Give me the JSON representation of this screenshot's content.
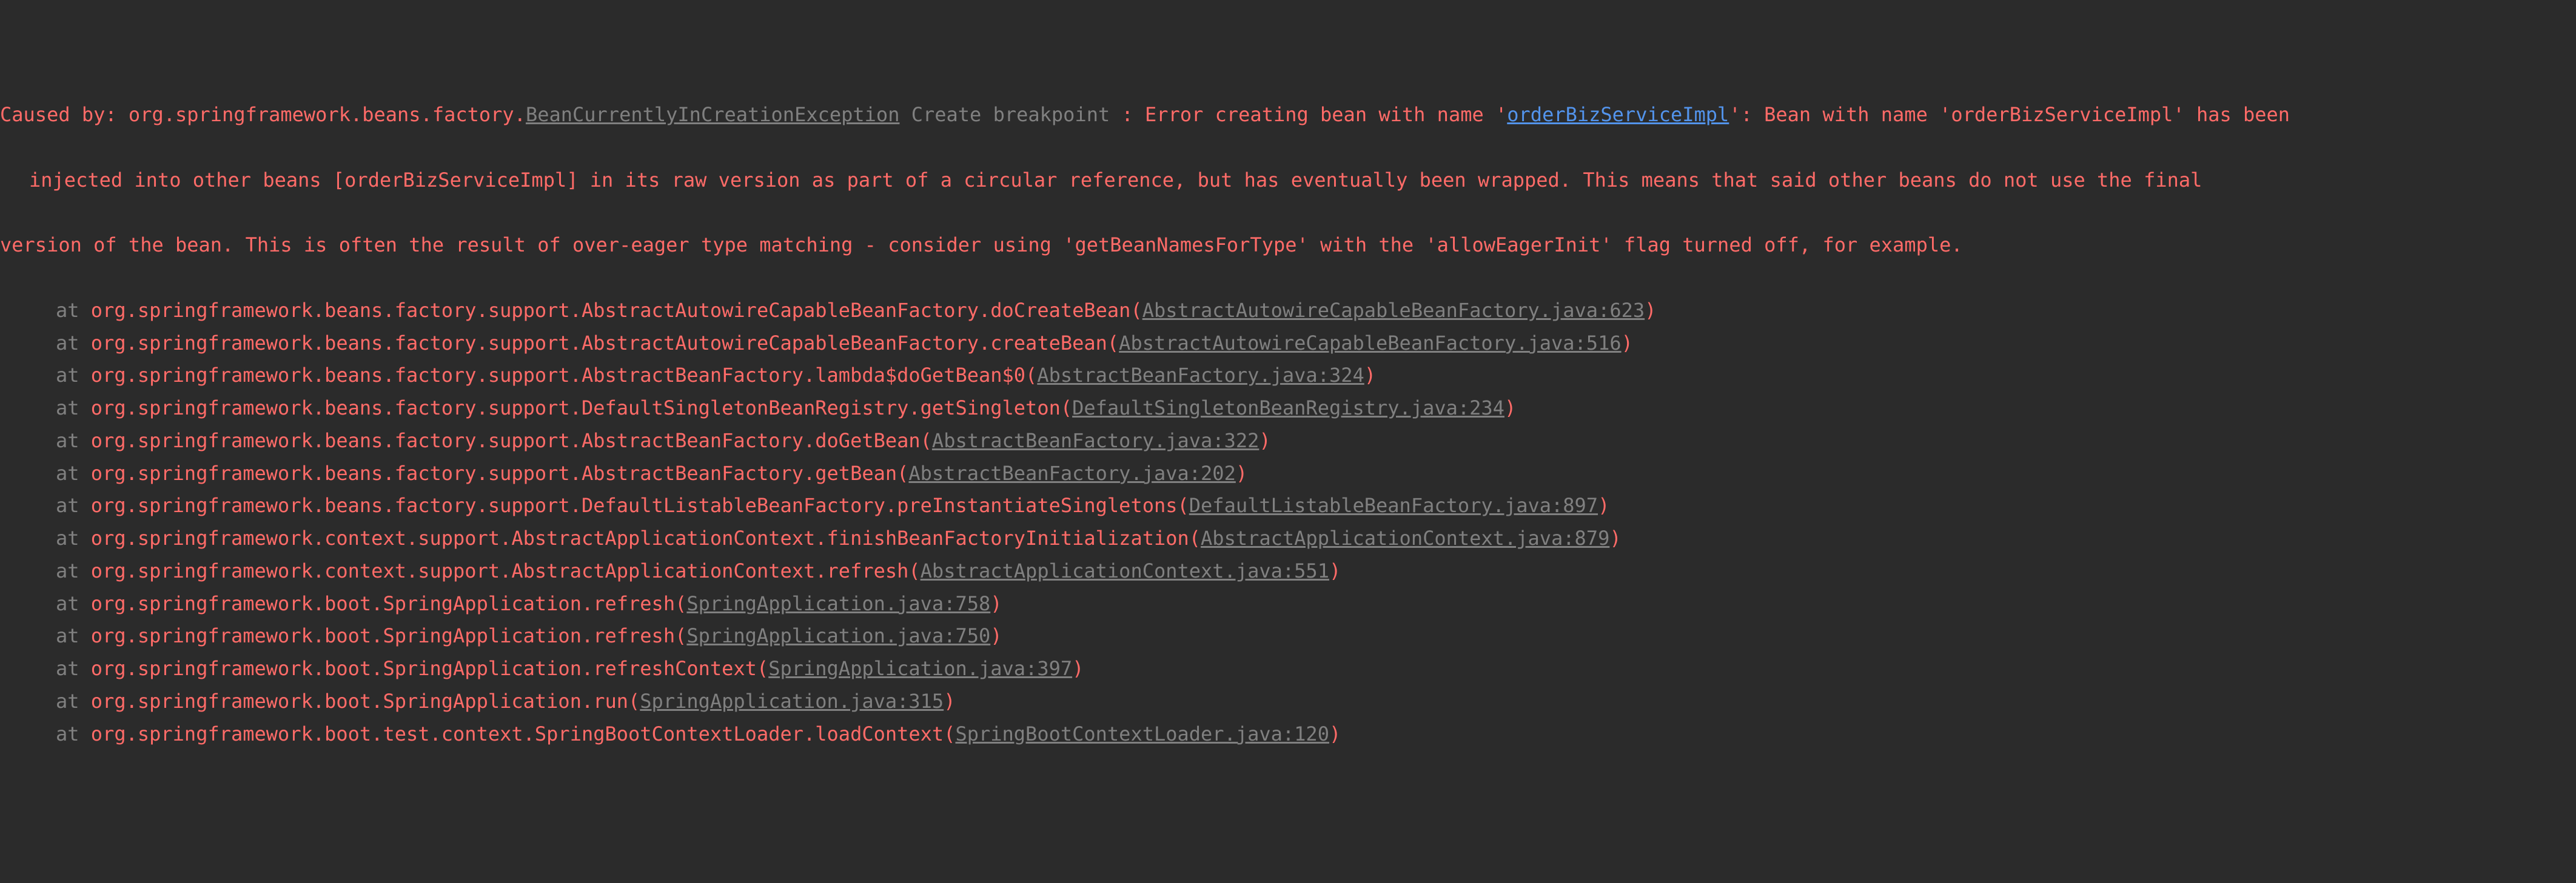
{
  "header": {
    "pre_exc": "Caused by: org.springframework.beans.factory.",
    "exc_class": "BeanCurrentlyInCreationException",
    "breakpoint_label": " Create breakpoint ",
    "msg1_a": ": Error creating bean with name '",
    "bean": "orderBizServiceImpl",
    "msg1_b": "': Bean with name 'orderBizServiceImpl' has been",
    "msg2": "injected into other beans [orderBizServiceImpl] in its raw version as part of a circular reference, but has eventually been wrapped. This means that said other beans do not use the final",
    "msg3": "version of the bean. This is often the result of over-eager type matching - consider using 'getBeanNamesForType' with the 'allowEagerInit' flag turned off, for example."
  },
  "frames": [
    {
      "at": "at ",
      "m": "org.springframework.beans.factory.support.AbstractAutowireCapableBeanFactory.doCreateBean",
      "o": "(",
      "f": "AbstractAutowireCapableBeanFactory.java:623",
      "c": ")"
    },
    {
      "at": "at ",
      "m": "org.springframework.beans.factory.support.AbstractAutowireCapableBeanFactory.createBean",
      "o": "(",
      "f": "AbstractAutowireCapableBeanFactory.java:516",
      "c": ")"
    },
    {
      "at": "at ",
      "m": "org.springframework.beans.factory.support.AbstractBeanFactory.lambda$doGetBean$0",
      "o": "(",
      "f": "AbstractBeanFactory.java:324",
      "c": ")"
    },
    {
      "at": "at ",
      "m": "org.springframework.beans.factory.support.DefaultSingletonBeanRegistry.getSingleton",
      "o": "(",
      "f": "DefaultSingletonBeanRegistry.java:234",
      "c": ")"
    },
    {
      "at": "at ",
      "m": "org.springframework.beans.factory.support.AbstractBeanFactory.doGetBean",
      "o": "(",
      "f": "AbstractBeanFactory.java:322",
      "c": ")"
    },
    {
      "at": "at ",
      "m": "org.springframework.beans.factory.support.AbstractBeanFactory.getBean",
      "o": "(",
      "f": "AbstractBeanFactory.java:202",
      "c": ")"
    },
    {
      "at": "at ",
      "m": "org.springframework.beans.factory.support.DefaultListableBeanFactory.preInstantiateSingletons",
      "o": "(",
      "f": "DefaultListableBeanFactory.java:897",
      "c": ")"
    },
    {
      "at": "at ",
      "m": "org.springframework.context.support.AbstractApplicationContext.finishBeanFactoryInitialization",
      "o": "(",
      "f": "AbstractApplicationContext.java:879",
      "c": ")"
    },
    {
      "at": "at ",
      "m": "org.springframework.context.support.AbstractApplicationContext.refresh",
      "o": "(",
      "f": "AbstractApplicationContext.java:551",
      "c": ")"
    },
    {
      "at": "at ",
      "m": "org.springframework.boot.SpringApplication.refresh",
      "o": "(",
      "f": "SpringApplication.java:758",
      "c": ")"
    },
    {
      "at": "at ",
      "m": "org.springframework.boot.SpringApplication.refresh",
      "o": "(",
      "f": "SpringApplication.java:750",
      "c": ")"
    },
    {
      "at": "at ",
      "m": "org.springframework.boot.SpringApplication.refreshContext",
      "o": "(",
      "f": "SpringApplication.java:397",
      "c": ")"
    },
    {
      "at": "at ",
      "m": "org.springframework.boot.SpringApplication.run",
      "o": "(",
      "f": "SpringApplication.java:315",
      "c": ")"
    },
    {
      "at": "at ",
      "m": "org.springframework.boot.test.context.SpringBootContextLoader.loadContext",
      "o": "(",
      "f": "SpringBootContextLoader.java:120",
      "c": ")"
    }
  ]
}
